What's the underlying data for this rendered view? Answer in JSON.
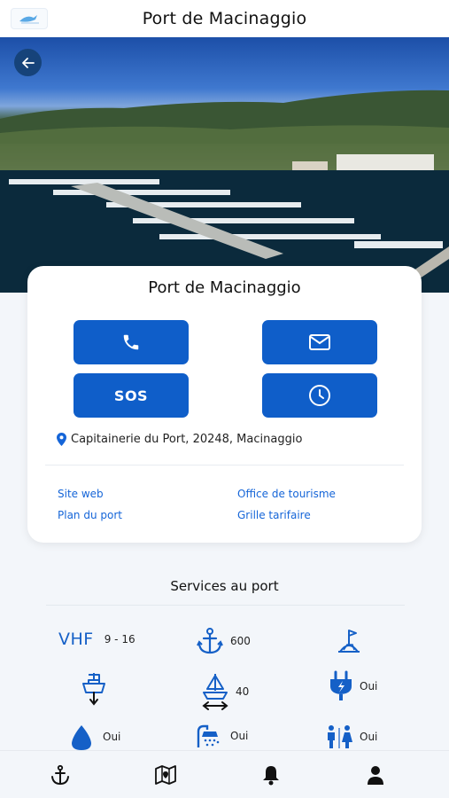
{
  "header": {
    "title": "Port de Macinaggio"
  },
  "card": {
    "title": "Port de Macinaggio",
    "sos_label": "SOS",
    "address": "Capitainerie du Port, 20248, Macinaggio",
    "links": {
      "website": "Site web",
      "tourism_office": "Office de tourisme",
      "port_plan": "Plan du port",
      "price_grid": "Grille tarifaire"
    }
  },
  "services": {
    "title": "Services au port",
    "vhf_label": "VHF",
    "vhf_channels": "9 - 16",
    "moorings": "600",
    "max_length": "40",
    "electricity": "Oui",
    "fuel": "Oui",
    "showers": "Oui",
    "toilets": "Oui"
  },
  "colors": {
    "accent": "#0f5ec9",
    "link": "#1565d8",
    "back_button": "#16437a"
  },
  "icons": [
    "back-arrow-icon",
    "phone-icon",
    "mail-icon",
    "clock-icon",
    "location-pin-icon",
    "anchor-icon",
    "slipway-icon",
    "crane-icon",
    "boat-length-icon",
    "electric-plug-icon",
    "fuel-drop-icon",
    "shower-icon",
    "toilets-icon",
    "map-icon",
    "bell-icon",
    "user-icon"
  ]
}
